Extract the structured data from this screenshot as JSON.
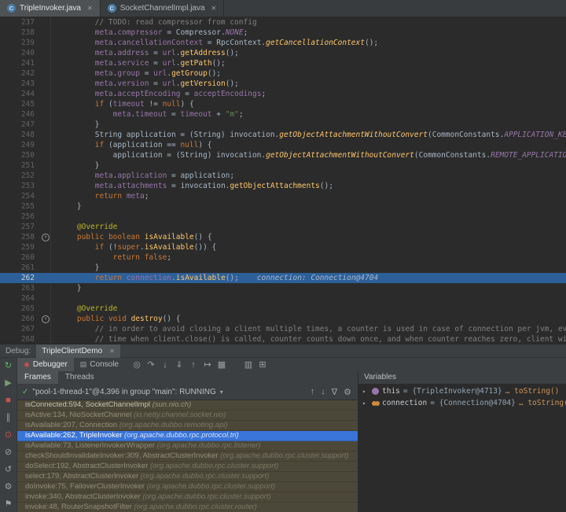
{
  "colors": {
    "execution_line": "#2d6099",
    "selected_frame": "#3974d8",
    "library_frame": "#4c4839",
    "stop_red": "#c75450",
    "run_green": "#5fb865"
  },
  "icons": {
    "close": "✕",
    "check": "✓",
    "chevron_down": "▾",
    "expand": "▸",
    "override": "↑",
    "file_class": "C",
    "debugger": "◉",
    "console": "▤"
  },
  "tabs": {
    "items": [
      {
        "label": "TripleInvoker.java"
      },
      {
        "label": "SocketChannelImpl.java"
      }
    ]
  },
  "editor": {
    "lines": [
      {
        "n": 237,
        "t": [
          [
            "c",
            "        // TODO: read compressor from config"
          ]
        ]
      },
      {
        "n": 238,
        "t": [
          [
            "p",
            "        "
          ],
          [
            "f",
            "meta"
          ],
          [
            "p",
            "."
          ],
          [
            "f",
            "compressor"
          ],
          [
            "p",
            " = Compressor."
          ],
          [
            "fi",
            "NONE"
          ],
          [
            "p",
            ";"
          ]
        ]
      },
      {
        "n": 239,
        "t": [
          [
            "p",
            "        "
          ],
          [
            "f",
            "meta"
          ],
          [
            "p",
            "."
          ],
          [
            "f",
            "cancellationContext"
          ],
          [
            "p",
            " = RpcContext."
          ],
          [
            "mi",
            "getCancellationContext"
          ],
          [
            "p",
            "();"
          ]
        ]
      },
      {
        "n": 240,
        "t": [
          [
            "p",
            "        "
          ],
          [
            "f",
            "meta"
          ],
          [
            "p",
            "."
          ],
          [
            "f",
            "address"
          ],
          [
            "p",
            " = "
          ],
          [
            "f",
            "url"
          ],
          [
            "p",
            "."
          ],
          [
            "m",
            "getAddress"
          ],
          [
            "p",
            "();"
          ]
        ]
      },
      {
        "n": 241,
        "t": [
          [
            "p",
            "        "
          ],
          [
            "f",
            "meta"
          ],
          [
            "p",
            "."
          ],
          [
            "f",
            "service"
          ],
          [
            "p",
            " = "
          ],
          [
            "f",
            "url"
          ],
          [
            "p",
            "."
          ],
          [
            "m",
            "getPath"
          ],
          [
            "p",
            "();"
          ]
        ]
      },
      {
        "n": 242,
        "t": [
          [
            "p",
            "        "
          ],
          [
            "f",
            "meta"
          ],
          [
            "p",
            "."
          ],
          [
            "f",
            "group"
          ],
          [
            "p",
            " = "
          ],
          [
            "f",
            "url"
          ],
          [
            "p",
            "."
          ],
          [
            "m",
            "getGroup"
          ],
          [
            "p",
            "();"
          ]
        ]
      },
      {
        "n": 243,
        "t": [
          [
            "p",
            "        "
          ],
          [
            "f",
            "meta"
          ],
          [
            "p",
            "."
          ],
          [
            "f",
            "version"
          ],
          [
            "p",
            " = "
          ],
          [
            "f",
            "url"
          ],
          [
            "p",
            "."
          ],
          [
            "m",
            "getVersion"
          ],
          [
            "p",
            "();"
          ]
        ]
      },
      {
        "n": 244,
        "t": [
          [
            "p",
            "        "
          ],
          [
            "f",
            "meta"
          ],
          [
            "p",
            "."
          ],
          [
            "f",
            "acceptEncoding"
          ],
          [
            "p",
            " = "
          ],
          [
            "f",
            "acceptEncodings"
          ],
          [
            "p",
            ";"
          ]
        ]
      },
      {
        "n": 245,
        "t": [
          [
            "p",
            "        "
          ],
          [
            "k",
            "if"
          ],
          [
            "p",
            " ("
          ],
          [
            "f",
            "timeout"
          ],
          [
            "p",
            " != "
          ],
          [
            "k",
            "null"
          ],
          [
            "p",
            ") {"
          ]
        ]
      },
      {
        "n": 246,
        "t": [
          [
            "p",
            "            "
          ],
          [
            "f",
            "meta"
          ],
          [
            "p",
            "."
          ],
          [
            "f",
            "timeout"
          ],
          [
            "p",
            " = "
          ],
          [
            "f",
            "timeout"
          ],
          [
            "p",
            " + "
          ],
          [
            "s",
            "\"m\""
          ],
          [
            "p",
            ";"
          ]
        ]
      },
      {
        "n": 247,
        "t": [
          [
            "p",
            "        }"
          ]
        ]
      },
      {
        "n": 248,
        "t": [
          [
            "p",
            "        String application = (String) invocation."
          ],
          [
            "mi",
            "getObjectAttachmentWithoutConvert"
          ],
          [
            "p",
            "(CommonConstants."
          ],
          [
            "fi",
            "APPLICATION_KEY"
          ],
          [
            "p",
            ");"
          ]
        ]
      },
      {
        "n": 249,
        "t": [
          [
            "p",
            "        "
          ],
          [
            "k",
            "if"
          ],
          [
            "p",
            " (application == "
          ],
          [
            "k",
            "null"
          ],
          [
            "p",
            ") {"
          ]
        ]
      },
      {
        "n": 250,
        "t": [
          [
            "p",
            "            application = (String) invocation."
          ],
          [
            "mi",
            "getObjectAttachmentWithoutConvert"
          ],
          [
            "p",
            "(CommonConstants."
          ],
          [
            "fi",
            "REMOTE_APPLICATION_KEY"
          ],
          [
            "p",
            ");"
          ]
        ]
      },
      {
        "n": 251,
        "t": [
          [
            "p",
            "        }"
          ]
        ]
      },
      {
        "n": 252,
        "t": [
          [
            "p",
            "        "
          ],
          [
            "f",
            "meta"
          ],
          [
            "p",
            "."
          ],
          [
            "f",
            "application"
          ],
          [
            "p",
            " = application;"
          ]
        ]
      },
      {
        "n": 253,
        "t": [
          [
            "p",
            "        "
          ],
          [
            "f",
            "meta"
          ],
          [
            "p",
            "."
          ],
          [
            "f",
            "attachments"
          ],
          [
            "p",
            " = invocation."
          ],
          [
            "m",
            "getObjectAttachments"
          ],
          [
            "p",
            "();"
          ]
        ]
      },
      {
        "n": 254,
        "t": [
          [
            "p",
            "        "
          ],
          [
            "k",
            "return"
          ],
          [
            "p",
            " "
          ],
          [
            "f",
            "meta"
          ],
          [
            "p",
            ";"
          ]
        ]
      },
      {
        "n": 255,
        "t": [
          [
            "p",
            "    }"
          ]
        ]
      },
      {
        "n": 256,
        "t": []
      },
      {
        "n": 257,
        "t": [
          [
            "p",
            "    "
          ],
          [
            "a",
            "@Override"
          ]
        ]
      },
      {
        "n": 258,
        "g": "override",
        "t": [
          [
            "p",
            "    "
          ],
          [
            "k",
            "public"
          ],
          [
            "p",
            " "
          ],
          [
            "k",
            "boolean"
          ],
          [
            "p",
            " "
          ],
          [
            "m",
            "isAvailable"
          ],
          [
            "p",
            "() {"
          ]
        ]
      },
      {
        "n": 259,
        "t": [
          [
            "p",
            "        "
          ],
          [
            "k",
            "if"
          ],
          [
            "p",
            " (!"
          ],
          [
            "k",
            "super"
          ],
          [
            "p",
            "."
          ],
          [
            "m",
            "isAvailable"
          ],
          [
            "p",
            "()) {"
          ]
        ]
      },
      {
        "n": 260,
        "t": [
          [
            "p",
            "            "
          ],
          [
            "k",
            "return"
          ],
          [
            "p",
            " "
          ],
          [
            "k",
            "false"
          ],
          [
            "p",
            ";"
          ]
        ]
      },
      {
        "n": 261,
        "t": [
          [
            "p",
            "        }"
          ]
        ]
      },
      {
        "n": 262,
        "cur": true,
        "t": [
          [
            "p",
            "        "
          ],
          [
            "k",
            "return"
          ],
          [
            "p",
            " "
          ],
          [
            "f",
            "connection"
          ],
          [
            "p",
            "."
          ],
          [
            "m",
            "isAvailable"
          ],
          [
            "p",
            "();"
          ],
          [
            "h",
            "    connection: Connection@4704"
          ]
        ]
      },
      {
        "n": 263,
        "t": [
          [
            "p",
            "    }"
          ]
        ]
      },
      {
        "n": 264,
        "t": []
      },
      {
        "n": 265,
        "t": [
          [
            "p",
            "    "
          ],
          [
            "a",
            "@Override"
          ]
        ]
      },
      {
        "n": 266,
        "g": "override",
        "t": [
          [
            "p",
            "    "
          ],
          [
            "k",
            "public"
          ],
          [
            "p",
            " "
          ],
          [
            "k",
            "void"
          ],
          [
            "p",
            " "
          ],
          [
            "m",
            "destroy"
          ],
          [
            "p",
            "() {"
          ]
        ]
      },
      {
        "n": 267,
        "t": [
          [
            "p",
            "        "
          ],
          [
            "c",
            "// in order to avoid closing a client multiple times, a counter is used in case of connection per jvm, every"
          ]
        ]
      },
      {
        "n": 268,
        "t": [
          [
            "p",
            "        "
          ],
          [
            "c",
            "// time when client.close() is called, counter counts down once, and when counter reaches zero, client will be"
          ]
        ]
      }
    ]
  },
  "debug": {
    "label": "Debug:",
    "session": {
      "label": "TripleClientDemo"
    },
    "tool_tabs": {
      "debugger": "Debugger",
      "console": "Console"
    },
    "view_tabs": {
      "frames": "Frames",
      "threads": "Threads"
    },
    "thread": {
      "text": "\"pool-1-thread-1\"@4,396 in group \"main\": RUNNING"
    },
    "stripe_icons": [
      {
        "name": "rerun-debug-icon",
        "glyph": "↻",
        "color": "#5fb865"
      },
      {
        "name": "resume-icon",
        "glyph": "▶",
        "color": "#7a9d77"
      },
      {
        "name": "stop-icon",
        "glyph": "■",
        "color": "#c75450"
      },
      {
        "name": "pause-icon",
        "glyph": "∥",
        "color": "#9da0a3"
      },
      {
        "name": "view-breakpoints-icon",
        "glyph": "⊙",
        "color": "#c75450"
      },
      {
        "name": "mute-breakpoints-icon",
        "glyph": "⊘",
        "color": "#9da0a3"
      },
      {
        "name": "restore-layout-icon",
        "glyph": "↺",
        "color": "#9da0a3"
      },
      {
        "name": "settings-gear-icon",
        "glyph": "⚙",
        "color": "#9da0a3"
      },
      {
        "name": "pin-icon",
        "glyph": "⚑",
        "color": "#9da0a3"
      }
    ],
    "step_icons": [
      {
        "name": "show-execution-point-icon",
        "glyph": "◎"
      },
      {
        "name": "step-over-icon",
        "glyph": "↷"
      },
      {
        "name": "step-into-icon",
        "glyph": "↓"
      },
      {
        "name": "force-step-into-icon",
        "glyph": "⇓"
      },
      {
        "name": "step-out-icon",
        "glyph": "↑"
      },
      {
        "name": "run-to-cursor-icon",
        "glyph": "↦"
      },
      {
        "name": "evaluate-expression-icon",
        "glyph": "▦"
      },
      {
        "name": "thread-dump-icon",
        "glyph": "▥"
      },
      {
        "name": "layout-settings-icon",
        "glyph": "⊞"
      }
    ],
    "frame_nav_icons": [
      {
        "name": "previous-frame-icon",
        "glyph": "↑"
      },
      {
        "name": "next-frame-icon",
        "glyph": "↓"
      },
      {
        "name": "filter-frames-icon",
        "glyph": "∇"
      },
      {
        "name": "frames-settings-icon",
        "glyph": "⚙"
      }
    ],
    "frames": [
      {
        "loc": "isConnected:594, SocketChannelImpl",
        "pkg": "(sun.nio.ch)",
        "style": "top"
      },
      {
        "loc": "isActive:134, NioSocketChannel",
        "pkg": "(io.netty.channel.socket.nio)",
        "style": "lib"
      },
      {
        "loc": "isAvailable:207, Connection",
        "pkg": "(org.apache.dubbo.remoting.api)",
        "style": "lib"
      },
      {
        "loc": "isAvailable:262, TripleInvoker",
        "pkg": "(org.apache.dubbo.rpc.protocol.tri)",
        "style": "selected"
      },
      {
        "loc": "isAvailable:73, ListenerInvokerWrapper",
        "pkg": "(org.apache.dubbo.rpc.listener)",
        "style": "lib"
      },
      {
        "loc": "checkShouldInvalidateInvoker:309, AbstractClusterInvoker",
        "pkg": "(org.apache.dubbo.rpc.cluster.support)",
        "style": "lib"
      },
      {
        "loc": "doSelect:192, AbstractClusterInvoker",
        "pkg": "(org.apache.dubbo.rpc.cluster.support)",
        "style": "lib"
      },
      {
        "loc": "select:179, AbstractClusterInvoker",
        "pkg": "(org.apache.dubbo.rpc.cluster.support)",
        "style": "lib"
      },
      {
        "loc": "doInvoke:75, FailoverClusterInvoker",
        "pkg": "(org.apache.dubbo.rpc.cluster.support)",
        "style": "lib"
      },
      {
        "loc": "invoke:340, AbstractClusterInvoker",
        "pkg": "(org.apache.dubbo.rpc.cluster.support)",
        "style": "lib"
      },
      {
        "loc": "invoke:48, RouterSnapshotFilter",
        "pkg": "(org.apache.dubbo.rpc.cluster.router)",
        "style": "lib"
      }
    ],
    "variables": {
      "header": "Variables",
      "items": [
        {
          "name": "this",
          "value": "{TripleInvoker@4713} ",
          "link": "… toString()",
          "icon": "variable"
        },
        {
          "name": "connection",
          "value": "{Connection@4704} ",
          "link": "… toString()",
          "icon": "watch"
        }
      ]
    }
  }
}
